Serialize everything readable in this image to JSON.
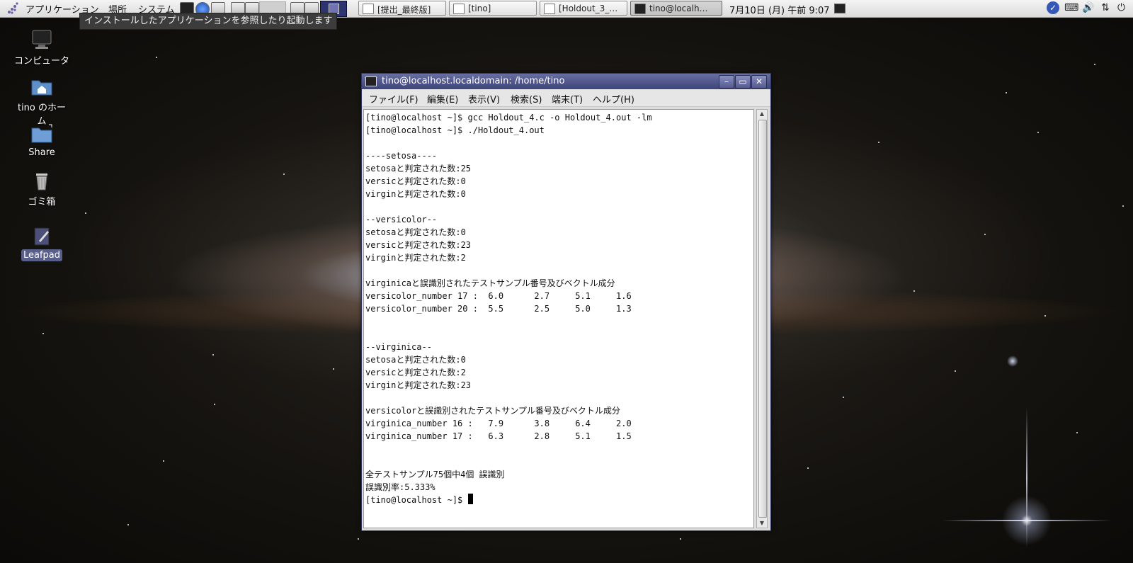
{
  "panel": {
    "menus": [
      "アプリケーション",
      "場所",
      "システム"
    ],
    "tasks": [
      {
        "label": "[提出_最終版]"
      },
      {
        "label": "[tino]"
      },
      {
        "label": "[Holdout_3_…"
      },
      {
        "label": "tino@localh…"
      }
    ],
    "clock": "7月10日 (月) 午前 9:07"
  },
  "tooltip": "インストールしたアプリケーションを参照したり起動します",
  "desktop_icons": [
    {
      "label": "コンピュータ",
      "icon": "computer-icon"
    },
    {
      "label": "tino のホーム",
      "icon": "home-folder-icon"
    },
    {
      "label": "Share",
      "icon": "folder-link-icon"
    },
    {
      "label": "ゴミ箱",
      "icon": "trash-icon"
    },
    {
      "label": "Leafpad",
      "icon": "leafpad-icon"
    }
  ],
  "window": {
    "title": "tino@localhost.localdomain: /home/tino",
    "menus": [
      "ファイル(F)",
      "編集(E)",
      "表示(V)",
      "検索(S)",
      "端末(T)",
      "ヘルプ(H)"
    ],
    "terminal_lines": [
      "[tino@localhost ~]$ gcc Holdout_4.c -o Holdout_4.out -lm",
      "[tino@localhost ~]$ ./Holdout_4.out",
      "",
      "----setosa----",
      "setosaと判定された数:25",
      "versicと判定された数:0",
      "virginと判定された数:0",
      "",
      "--versicolor--",
      "setosaと判定された数:0",
      "versicと判定された数:23",
      "virginと判定された数:2",
      "",
      "virginicaと誤識別されたテストサンプル番号及びベクトル成分",
      "versicolor_number 17 :  6.0      2.7     5.1     1.6",
      "versicolor_number 20 :  5.5      2.5     5.0     1.3",
      "",
      "",
      "--virginica--",
      "setosaと判定された数:0",
      "versicと判定された数:2",
      "virginと判定された数:23",
      "",
      "versicolorと誤識別されたテストサンプル番号及びベクトル成分",
      "virginica_number 16 :   7.9      3.8     6.4     2.0",
      "virginica_number 17 :   6.3      2.8     5.1     1.5",
      "",
      "",
      "全テストサンプル75個中4個 誤識別",
      "誤識別率:5.333%"
    ],
    "prompt": "[tino@localhost ~]$ "
  }
}
